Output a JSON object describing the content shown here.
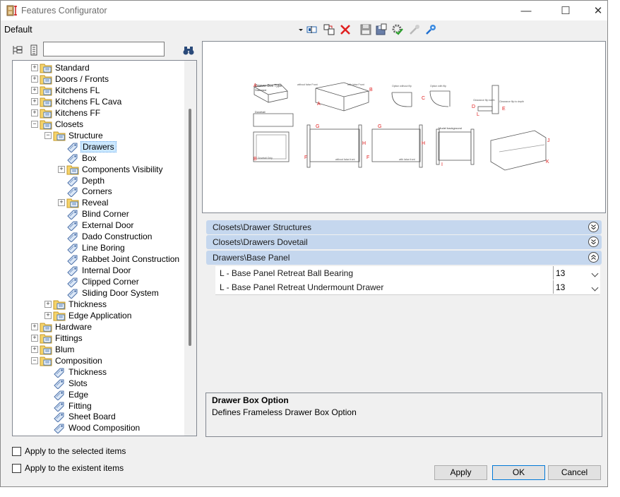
{
  "window": {
    "title": "Features Configurator",
    "minimize": "—",
    "maximize": "☐",
    "close": "✕"
  },
  "profile": "Default",
  "search": {
    "value": "",
    "placeholder": ""
  },
  "tree": [
    {
      "label": "Standard",
      "indent": 0,
      "expander": "+",
      "icon": "folder"
    },
    {
      "label": "Doors / Fronts",
      "indent": 0,
      "expander": "+",
      "icon": "folder"
    },
    {
      "label": "Kitchens FL",
      "indent": 0,
      "expander": "+",
      "icon": "folder"
    },
    {
      "label": "Kitchens FL Cava",
      "indent": 0,
      "expander": "+",
      "icon": "folder"
    },
    {
      "label": "Kitchens FF",
      "indent": 0,
      "expander": "+",
      "icon": "folder"
    },
    {
      "label": "Closets",
      "indent": 0,
      "expander": "−",
      "icon": "folder"
    },
    {
      "label": "Structure",
      "indent": 1,
      "expander": "−",
      "icon": "folder"
    },
    {
      "label": "Drawers",
      "indent": 2,
      "expander": "",
      "icon": "tag",
      "selected": true
    },
    {
      "label": "Box",
      "indent": 2,
      "expander": "",
      "icon": "tag"
    },
    {
      "label": "Components Visibility",
      "indent": 2,
      "expander": "+",
      "icon": "folder"
    },
    {
      "label": "Depth",
      "indent": 2,
      "expander": "",
      "icon": "tag"
    },
    {
      "label": "Corners",
      "indent": 2,
      "expander": "",
      "icon": "tag"
    },
    {
      "label": "Reveal",
      "indent": 2,
      "expander": "+",
      "icon": "folder"
    },
    {
      "label": "Blind Corner",
      "indent": 2,
      "expander": "",
      "icon": "tag"
    },
    {
      "label": "External Door",
      "indent": 2,
      "expander": "",
      "icon": "tag"
    },
    {
      "label": "Dado Construction",
      "indent": 2,
      "expander": "",
      "icon": "tag"
    },
    {
      "label": "Line Boring",
      "indent": 2,
      "expander": "",
      "icon": "tag"
    },
    {
      "label": "Rabbet Joint Construction",
      "indent": 2,
      "expander": "",
      "icon": "tag"
    },
    {
      "label": "Internal Door",
      "indent": 2,
      "expander": "",
      "icon": "tag"
    },
    {
      "label": "Clipped Corner",
      "indent": 2,
      "expander": "",
      "icon": "tag"
    },
    {
      "label": "Sliding Door System",
      "indent": 2,
      "expander": "",
      "icon": "tag"
    },
    {
      "label": "Thickness",
      "indent": 1,
      "expander": "+",
      "icon": "folder"
    },
    {
      "label": "Edge Application",
      "indent": 1,
      "expander": "+",
      "icon": "folder"
    },
    {
      "label": "Hardware",
      "indent": 0,
      "expander": "+",
      "icon": "folder"
    },
    {
      "label": "Fittings",
      "indent": 0,
      "expander": "+",
      "icon": "folder"
    },
    {
      "label": "Blum",
      "indent": 0,
      "expander": "+",
      "icon": "folder"
    },
    {
      "label": "Composition",
      "indent": 0,
      "expander": "−",
      "icon": "folder"
    },
    {
      "label": "Thickness",
      "indent": 1,
      "expander": "",
      "icon": "tag"
    },
    {
      "label": "Slots",
      "indent": 1,
      "expander": "",
      "icon": "tag"
    },
    {
      "label": "Edge",
      "indent": 1,
      "expander": "",
      "icon": "tag"
    },
    {
      "label": "Fitting",
      "indent": 1,
      "expander": "",
      "icon": "tag"
    },
    {
      "label": "Sheet Board",
      "indent": 1,
      "expander": "",
      "icon": "tag"
    },
    {
      "label": "Wood Composition",
      "indent": 1,
      "expander": "",
      "icon": "tag"
    }
  ],
  "preview": {
    "heading": "Drawer Box Type",
    "subheading": "Standard",
    "dovetail": "Dovetail",
    "captions": [
      "without false Front",
      "with false Front",
      "Option without flip",
      "Option with flip",
      "Clearance flip width",
      "Clearance flip to depth",
      "Model background",
      "without false front",
      "with false front",
      "Dovetail Only"
    ],
    "letters": [
      "A",
      "B",
      "C",
      "D",
      "E",
      "L",
      "G",
      "H",
      "F",
      "G",
      "H",
      "F",
      "I",
      "J",
      "K",
      "A",
      "B"
    ]
  },
  "sections": [
    {
      "title": "Closets\\Drawer Structures",
      "expanded": false
    },
    {
      "title": "Closets\\Drawers Dovetail",
      "expanded": false
    },
    {
      "title": "Drawers\\Base Panel",
      "expanded": true
    }
  ],
  "properties": [
    {
      "name": "L - Base Panel Retreat Ball Bearing",
      "value": "13"
    },
    {
      "name": "L - Base Panel Retreat Undermount Drawer",
      "value": "13"
    }
  ],
  "description": {
    "title": "Drawer Box Option",
    "text": "Defines Frameless Drawer Box Option"
  },
  "options": {
    "apply_selected": "Apply to the selected items",
    "apply_existent": "Apply to the existent items"
  },
  "buttons": {
    "apply": "Apply",
    "ok": "OK",
    "cancel": "Cancel"
  },
  "colors": {
    "section_bg": "#c5d7ee",
    "selection": "#cce8ff",
    "accent_red": "#e02020"
  }
}
